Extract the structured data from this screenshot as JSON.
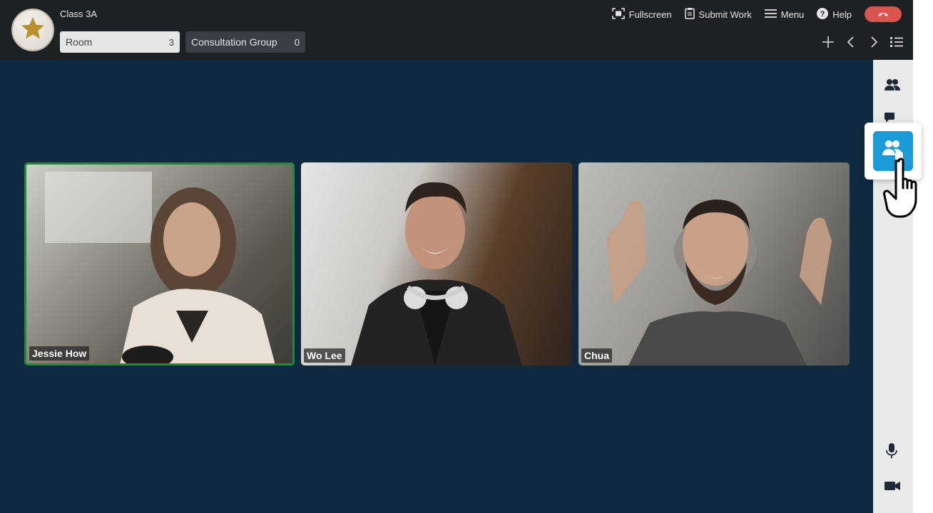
{
  "header": {
    "class_title": "Class 3A",
    "rooms": [
      {
        "label": "Room",
        "count": "3"
      },
      {
        "label": "Consultation Group",
        "count": "0"
      }
    ],
    "actions": {
      "fullscreen": "Fullscreen",
      "submit_work": "Submit Work",
      "menu": "Menu",
      "help": "Help"
    }
  },
  "participants": [
    {
      "name": "Jessie How",
      "active_speaker": true
    },
    {
      "name": "Wo Lee",
      "active_speaker": false
    },
    {
      "name": "Chua",
      "active_speaker": false
    }
  ],
  "colors": {
    "stage_bg": "#0f2a40",
    "topbar_bg": "#1e2124",
    "active_border": "#1f8a3a",
    "accent": "#1a9bd7",
    "end_call": "#d9534f"
  },
  "icons": {
    "logo": "star-icon",
    "sidebar": [
      "participants-icon",
      "chat-icon",
      "breakout-groups-icon",
      "microphone-icon",
      "camera-icon"
    ],
    "nav": [
      "plus-icon",
      "chevron-left-icon",
      "chevron-right-icon",
      "list-icon"
    ]
  }
}
